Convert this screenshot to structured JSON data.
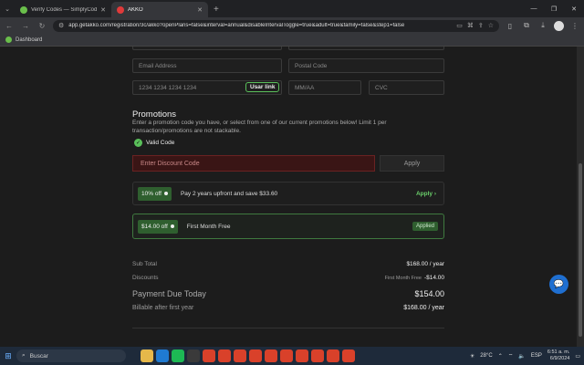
{
  "browser": {
    "tabs": [
      {
        "title": "Verify Codes — SimplyCodes",
        "active": false,
        "fav_color": "#6abf4b"
      },
      {
        "title": "AKKO",
        "active": true,
        "fav_color": "#e03a3a"
      }
    ],
    "url": "app.getakko.com/registration/3c/akko?openPlans=false&interval=annual&disableIntervalToggle=true&adult=true&family=false&step1=false",
    "bookmark": "Dashboard"
  },
  "form": {
    "email_placeholder": "Email Address",
    "postal_placeholder": "Postal Code",
    "card_placeholder": "1234 1234 1234 1234",
    "usar_link": "Usar link",
    "mmaa_placeholder": "MM/AA",
    "cvc_placeholder": "CVC"
  },
  "promotions": {
    "heading": "Promotions",
    "description": "Enter a promotion code you have, or select from one of our current promotions below! Limit 1 per transaction/promotions are not stackable.",
    "valid_label": "Valid Code",
    "discount_placeholder": "Enter Discount Code",
    "apply_button": "Apply",
    "cards": [
      {
        "pill": "10% off",
        "text": "Pay 2 years upfront and save $33.60",
        "action": "Apply ›"
      },
      {
        "pill": "$14.00 off",
        "text": "First Month Free",
        "action": "Applied"
      }
    ]
  },
  "summary": {
    "subtotal_label": "Sub Total",
    "subtotal_value": "$168.00 / year",
    "discounts_label": "Discounts",
    "discounts_note": "First Month Free",
    "discounts_value": "-$14.00",
    "due_label": "Payment Due Today",
    "due_value": "$154.00",
    "billable_label": "Billable after first year",
    "billable_value": "$168.00 / year"
  },
  "taskbar": {
    "search_placeholder": "Buscar",
    "temperature": "28°C",
    "language": "ESP",
    "time": "6:51 a. m.",
    "date": "6/9/2024"
  }
}
